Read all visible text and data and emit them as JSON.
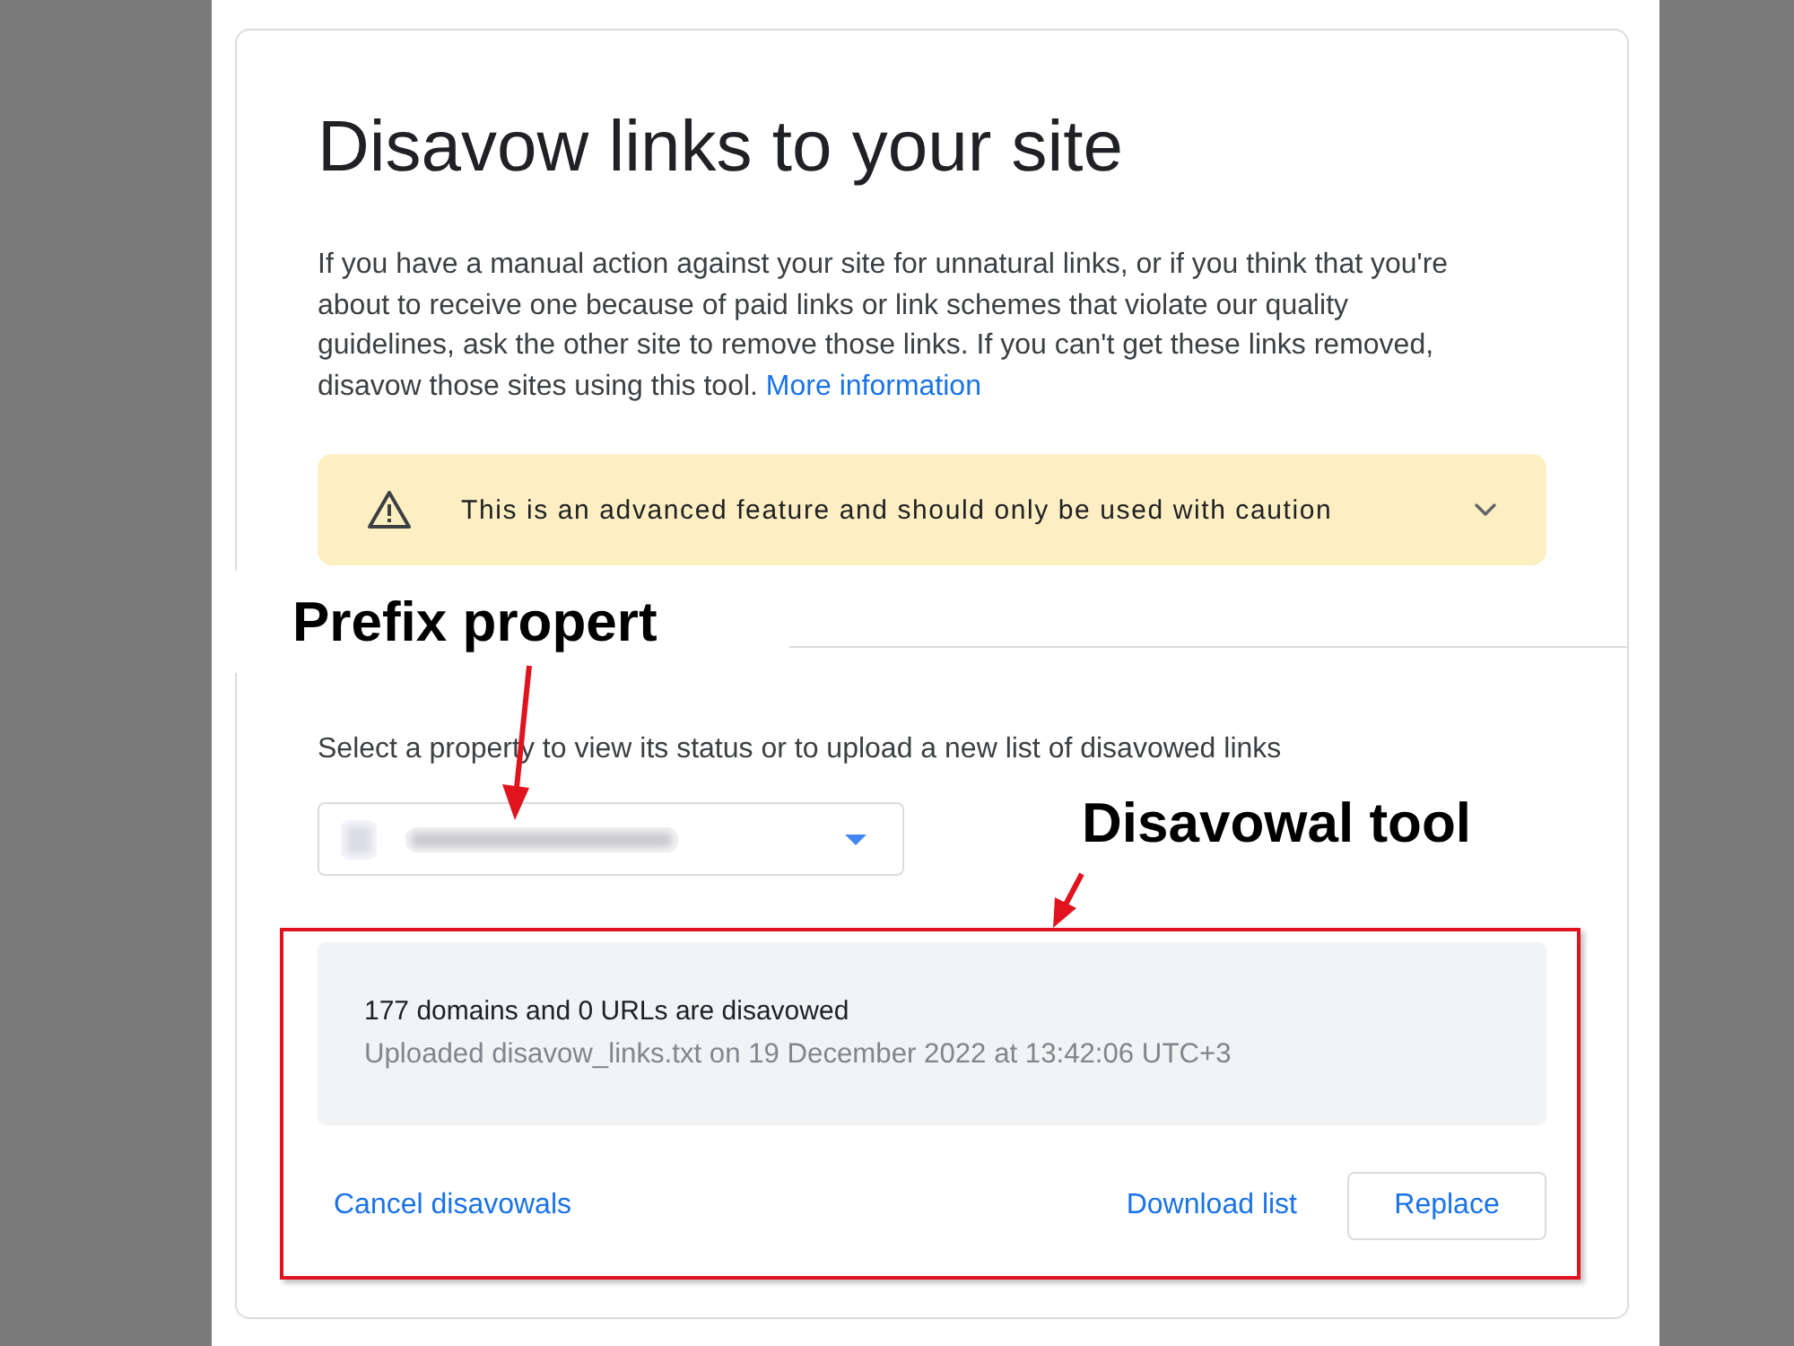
{
  "page": {
    "title": "Disavow links to your site",
    "intro": "If you have a manual action against your site for unnatural links, or if you think that you're about to receive one because of paid links or link schemes that violate our quality guidelines, ask the other site to remove those links. If you can't get these links removed, disavow those sites using this tool.",
    "intro_link": "More information"
  },
  "warning": {
    "text": "This is an advanced feature and should only be used with caution",
    "expanded": false
  },
  "property": {
    "prompt": "Select a property to view its status or to upload a new list of disavowed links"
  },
  "status": {
    "summary": "177 domains and 0 URLs are disavowed",
    "detail": "Uploaded disavow_links.txt on 19 December 2022 at 13:42:06 UTC+3"
  },
  "actions_start": [
    {
      "kind": "text",
      "label": "Cancel disavowals"
    }
  ],
  "actions_end": [
    {
      "kind": "text",
      "label": "Download list"
    },
    {
      "kind": "outlined",
      "label": "Replace"
    }
  ],
  "annotations": [
    {
      "text": "Prefix propert"
    },
    {
      "text": "Disavowal tool"
    }
  ]
}
